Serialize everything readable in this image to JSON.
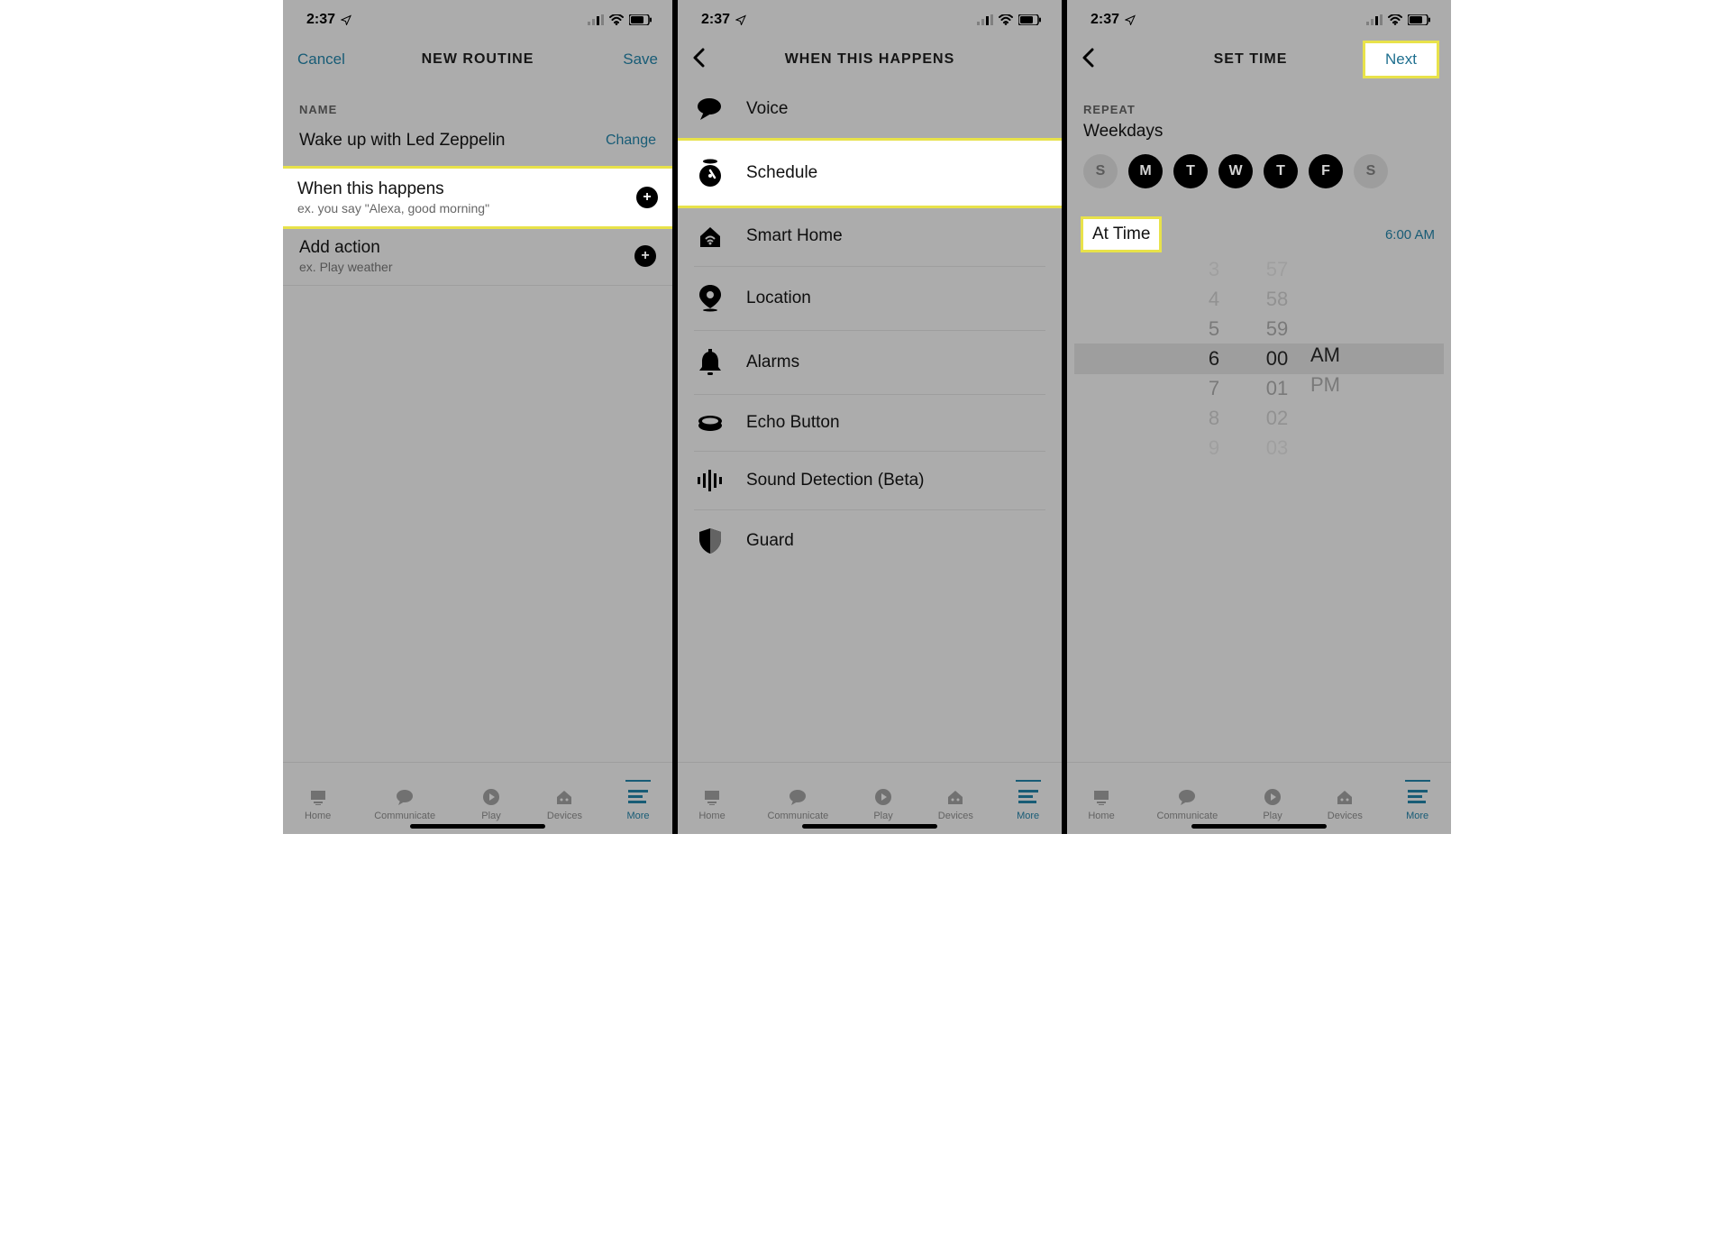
{
  "status": {
    "time": "2:37"
  },
  "tabs": {
    "home": "Home",
    "communicate": "Communicate",
    "play": "Play",
    "devices": "Devices",
    "more": "More"
  },
  "p1": {
    "cancel": "Cancel",
    "title": "NEW ROUTINE",
    "save": "Save",
    "section_name": "NAME",
    "routine_name": "Wake up with Led Zeppelin",
    "change": "Change",
    "when_title": "When this happens",
    "when_sub": "ex. you say \"Alexa, good morning\"",
    "add_title": "Add action",
    "add_sub": "ex. Play weather"
  },
  "p2": {
    "title": "WHEN THIS HAPPENS",
    "items": [
      {
        "label": "Voice"
      },
      {
        "label": "Schedule"
      },
      {
        "label": "Smart Home"
      },
      {
        "label": "Location"
      },
      {
        "label": "Alarms"
      },
      {
        "label": "Echo Button"
      },
      {
        "label": "Sound Detection (Beta)"
      },
      {
        "label": "Guard"
      }
    ]
  },
  "p3": {
    "title": "SET TIME",
    "next": "Next",
    "repeat": "REPEAT",
    "repeat_sub": "Weekdays",
    "days": [
      {
        "label": "S",
        "on": false
      },
      {
        "label": "M",
        "on": true
      },
      {
        "label": "T",
        "on": true
      },
      {
        "label": "W",
        "on": true
      },
      {
        "label": "T",
        "on": true
      },
      {
        "label": "F",
        "on": true
      },
      {
        "label": "S",
        "on": false
      }
    ],
    "attime": "At Time",
    "attime_val": "6:00 AM",
    "picker": {
      "hours": [
        "3",
        "4",
        "5",
        "6",
        "7",
        "8",
        "9"
      ],
      "mins": [
        "57",
        "58",
        "59",
        "00",
        "01",
        "02",
        "03"
      ],
      "ampm": [
        "AM",
        "PM"
      ]
    }
  }
}
